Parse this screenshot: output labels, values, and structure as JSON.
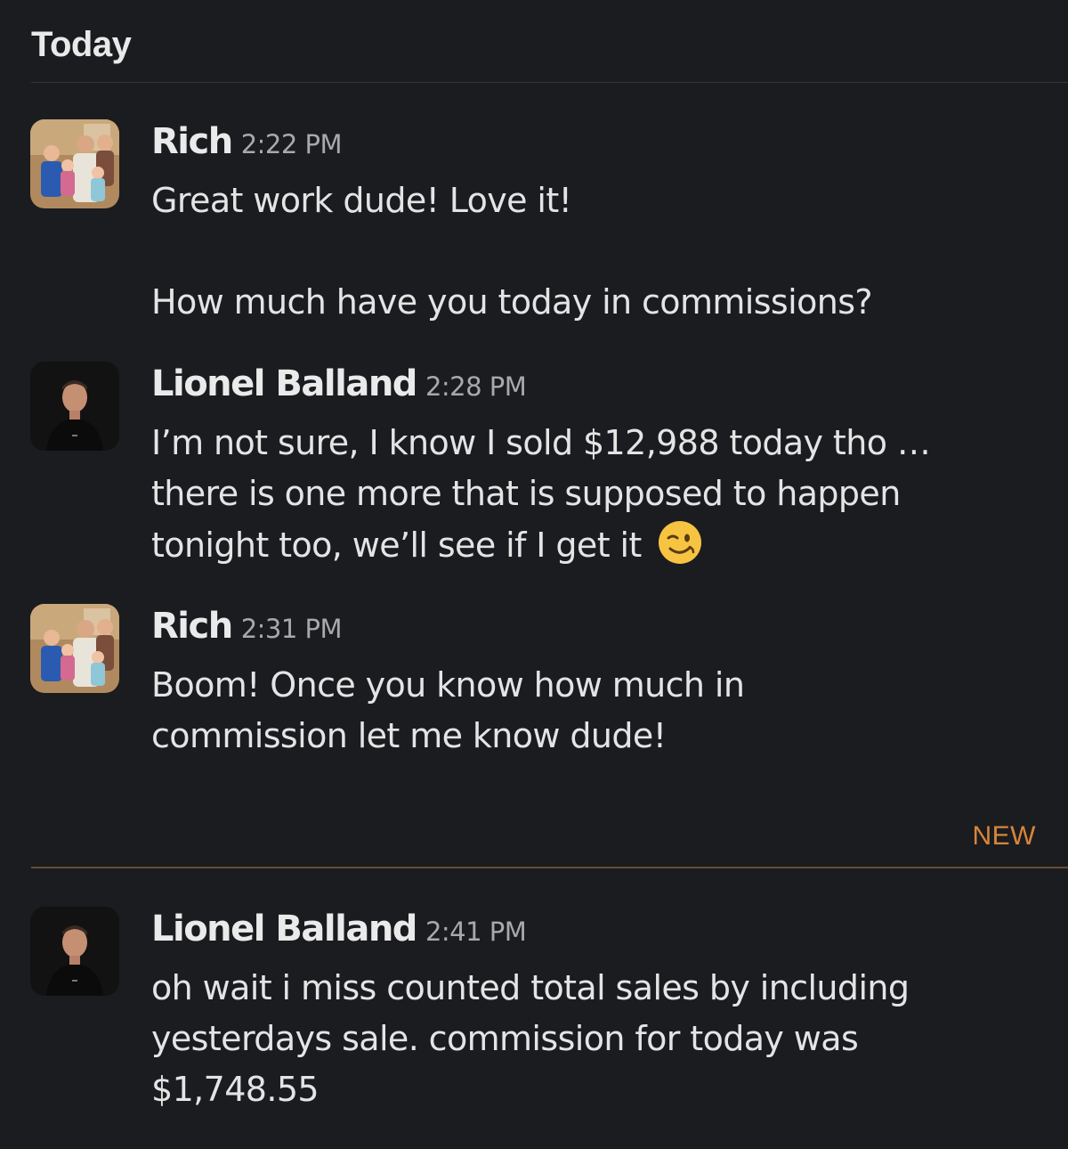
{
  "day_header": "Today",
  "new_divider_label": "NEW",
  "messages": [
    {
      "author": "Rich",
      "time": "2:22 PM",
      "avatar": "family-photo-avatar",
      "paragraphs": [
        "Great work dude! Love it!",
        "How much have you today in commissions?"
      ]
    },
    {
      "author": "Lionel Balland",
      "time": "2:28 PM",
      "avatar": "portrait-avatar",
      "lines": [
        "I’m not sure, I know I sold $12,988 today tho …",
        "there is one more that is supposed to happen",
        "tonight too, we’ll see if I get it"
      ],
      "emoji": "winking-face"
    },
    {
      "author": "Rich",
      "time": "2:31 PM",
      "avatar": "family-photo-avatar",
      "lines": [
        "Boom! Once you know how much in",
        "commission let me know dude!"
      ]
    },
    {
      "author": "Lionel Balland",
      "time": "2:41 PM",
      "avatar": "portrait-avatar",
      "lines": [
        "oh wait i miss counted total sales by including",
        "yesterdays sale. commission for today was",
        "$1,748.55"
      ]
    }
  ],
  "colors": {
    "background": "#1b1c1f",
    "text": "#e4e4e5",
    "timestamp": "#a9a9ad",
    "new_accent": "#d9853b"
  }
}
